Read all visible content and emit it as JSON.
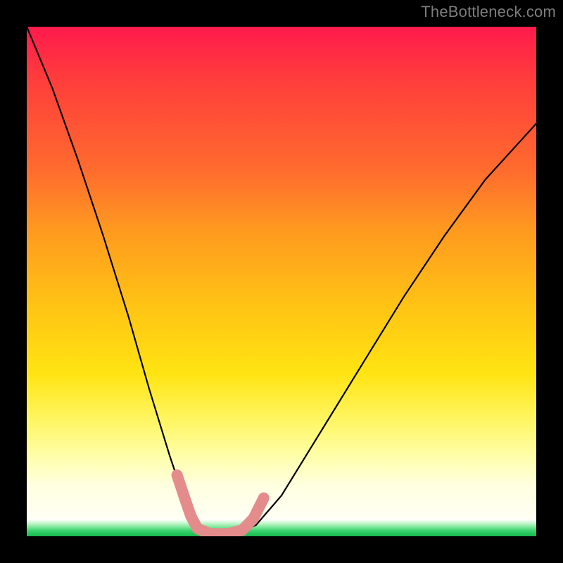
{
  "watermark": "TheBottleneck.com",
  "chart_data": {
    "type": "line",
    "title": "",
    "xlabel": "",
    "ylabel": "",
    "xlim": [
      0,
      1
    ],
    "ylim": [
      0,
      1
    ],
    "series": [
      {
        "name": "bottleneck-curve",
        "x": [
          0.0,
          0.05,
          0.1,
          0.15,
          0.2,
          0.24,
          0.28,
          0.31,
          0.33,
          0.355,
          0.4,
          0.45,
          0.5,
          0.58,
          0.66,
          0.74,
          0.82,
          0.9,
          1.0
        ],
        "y": [
          1.0,
          0.88,
          0.74,
          0.59,
          0.43,
          0.29,
          0.16,
          0.07,
          0.02,
          0.0,
          0.0,
          0.022,
          0.08,
          0.21,
          0.34,
          0.47,
          0.59,
          0.7,
          0.81
        ]
      }
    ],
    "annotations": [
      {
        "name": "valley-marker",
        "x": [
          0.295,
          0.31,
          0.322,
          0.335,
          0.36,
          0.395,
          0.423,
          0.445,
          0.465
        ],
        "y": [
          0.12,
          0.075,
          0.04,
          0.015,
          0.005,
          0.005,
          0.012,
          0.035,
          0.075
        ]
      }
    ],
    "colors": {
      "curve": "#000000",
      "marker": "#e48b8b",
      "gradient_top": "#ff1a4d",
      "gradient_bottom_green": "#18b94f"
    }
  }
}
